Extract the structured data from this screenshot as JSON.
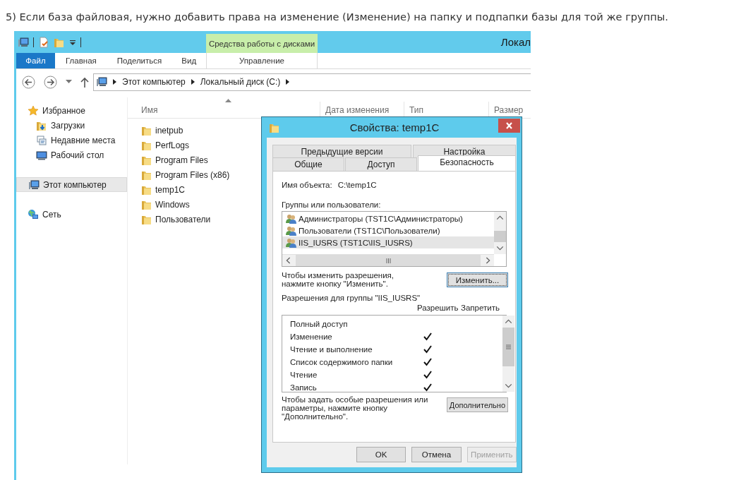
{
  "caption": "5) Если база файловая, нужно добавить права на изменение (Изменение) на папку и подпапки базы для той же группы.",
  "explorer": {
    "title": "Локал",
    "context_tab": {
      "group": "Средства работы с дисками",
      "label": "Управление"
    },
    "ribbon_tabs": [
      {
        "label": "Файл",
        "selected": true
      },
      {
        "label": "Главная",
        "selected": false
      },
      {
        "label": "Поделиться",
        "selected": false
      },
      {
        "label": "Вид",
        "selected": false
      }
    ],
    "breadcrumb": [
      "Этот компьютер",
      "Локальный диск (C:)"
    ],
    "nav": [
      {
        "label": "Избранное",
        "kind": "favorites",
        "selected": false,
        "children": [
          {
            "label": "Загрузки",
            "kind": "downloads",
            "selected": false
          },
          {
            "label": "Недавние места",
            "kind": "recent",
            "selected": false
          },
          {
            "label": "Рабочий стол",
            "kind": "desktop",
            "selected": false
          }
        ]
      },
      {
        "label": "Этот компьютер",
        "kind": "computer",
        "selected": true
      },
      {
        "label": "Сеть",
        "kind": "network",
        "selected": false
      }
    ],
    "columns": [
      "Имя",
      "Дата изменения",
      "Тип",
      "Размер"
    ],
    "files": [
      "inetpub",
      "PerfLogs",
      "Program Files",
      "Program Files (x86)",
      "temp1C",
      "Windows",
      "Пользователи"
    ]
  },
  "dialog": {
    "title": "Свойства: temp1C",
    "tabs_back": [
      {
        "label": "Предыдущие версии",
        "selected": false
      },
      {
        "label": "Настройка",
        "selected": false
      }
    ],
    "tabs_front": [
      {
        "label": "Общие",
        "selected": false
      },
      {
        "label": "Доступ",
        "selected": false
      },
      {
        "label": "Безопасность",
        "selected": true
      }
    ],
    "object_label": "Имя объекта:",
    "object_value": "C:\\temp1C",
    "groups_label": "Группы или пользователи:",
    "groups": [
      {
        "name": "Администраторы (TST1C\\Администраторы)",
        "selected": false
      },
      {
        "name": "Пользователи (TST1C\\Пользователи)",
        "selected": false
      },
      {
        "name": "IIS_IUSRS (TST1C\\IIS_IUSRS)",
        "selected": true
      }
    ],
    "change_hint": "Чтобы изменить разрешения,\nнажмите кнопку \"Изменить\".",
    "change_button": "Изменить...",
    "permissions_label": "Разрешения для группы \"IIS_IUSRS\"",
    "allow_header": "Разрешить",
    "deny_header": "Запретить",
    "permissions": [
      {
        "name": "Полный доступ",
        "allow": false,
        "deny": false
      },
      {
        "name": "Изменение",
        "allow": true,
        "deny": false
      },
      {
        "name": "Чтение и выполнение",
        "allow": true,
        "deny": false
      },
      {
        "name": "Список содержимого папки",
        "allow": true,
        "deny": false
      },
      {
        "name": "Чтение",
        "allow": true,
        "deny": false
      },
      {
        "name": "Запись",
        "allow": true,
        "deny": false
      }
    ],
    "advanced_hint": "Чтобы задать особые разрешения или\nпараметры, нажмите кнопку\n\"Дополнительно\".",
    "advanced_button": "Дополнительно",
    "buttons": [
      {
        "label": "OK",
        "disabled": false
      },
      {
        "label": "Отмена",
        "disabled": false
      },
      {
        "label": "Применить",
        "disabled": true
      }
    ]
  }
}
